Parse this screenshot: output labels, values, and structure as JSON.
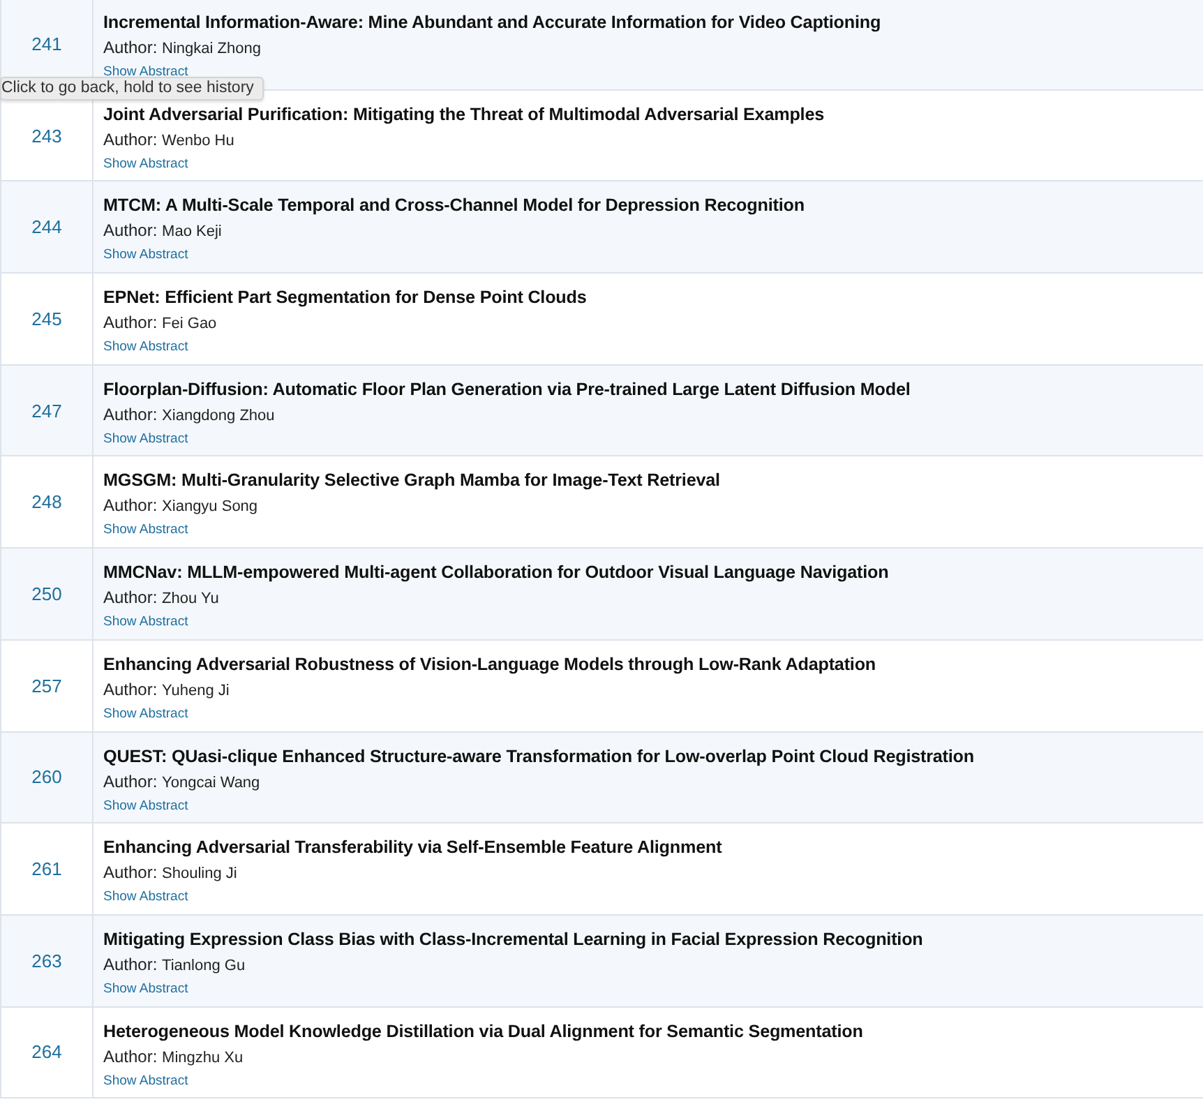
{
  "papers": [
    {
      "id": "241",
      "title": "Incremental Information-Aware: Mine Abundant and Accurate Information for Video Captioning",
      "author_label": "Author:",
      "author": "Ningkai Zhong",
      "link": "Show Abstract"
    },
    {
      "id": "243",
      "title": "Joint Adversarial Purification: Mitigating the Threat of Multimodal Adversarial Examples",
      "author_label": "Author:",
      "author": "Wenbo Hu",
      "link": "Show Abstract"
    },
    {
      "id": "244",
      "title": "MTCM: A Multi-Scale Temporal and Cross-Channel Model for Depression Recognition",
      "author_label": "Author:",
      "author": "Mao Keji",
      "link": "Show Abstract"
    },
    {
      "id": "245",
      "title": "EPNet: Efficient Part Segmentation for Dense Point Clouds",
      "author_label": "Author:",
      "author": "Fei Gao",
      "link": "Show Abstract"
    },
    {
      "id": "247",
      "title": "Floorplan-Diffusion: Automatic Floor Plan Generation via Pre-trained Large Latent Diffusion Model",
      "author_label": "Author:",
      "author": "Xiangdong Zhou",
      "link": "Show Abstract"
    },
    {
      "id": "248",
      "title": "MGSGM: Multi-Granularity Selective Graph Mamba for Image-Text Retrieval",
      "author_label": "Author:",
      "author": "Xiangyu Song",
      "link": "Show Abstract"
    },
    {
      "id": "250",
      "title": "MMCNav: MLLM-empowered Multi-agent Collaboration for Outdoor Visual Language Navigation",
      "author_label": "Author:",
      "author": "Zhou Yu",
      "link": "Show Abstract"
    },
    {
      "id": "257",
      "title": "Enhancing Adversarial Robustness of Vision-Language Models through Low-Rank Adaptation",
      "author_label": "Author:",
      "author": "Yuheng Ji",
      "link": "Show Abstract"
    },
    {
      "id": "260",
      "title": "QUEST: QUasi-clique Enhanced Structure-aware Transformation for Low-overlap Point Cloud Registration",
      "author_label": "Author:",
      "author": "Yongcai Wang",
      "link": "Show Abstract"
    },
    {
      "id": "261",
      "title": "Enhancing Adversarial Transferability via Self-Ensemble Feature Alignment",
      "author_label": "Author:",
      "author": "Shouling Ji",
      "link": "Show Abstract"
    },
    {
      "id": "263",
      "title": "Mitigating Expression Class Bias with Class-Incremental Learning in Facial Expression Recognition",
      "author_label": "Author:",
      "author": "Tianlong Gu",
      "link": "Show Abstract"
    },
    {
      "id": "264",
      "title": "Heterogeneous Model Knowledge Distillation via Dual Alignment for Semantic Segmentation",
      "author_label": "Author:",
      "author": "Mingzhu Xu",
      "link": "Show Abstract"
    }
  ],
  "tooltip": "Click to go back, hold to see history"
}
